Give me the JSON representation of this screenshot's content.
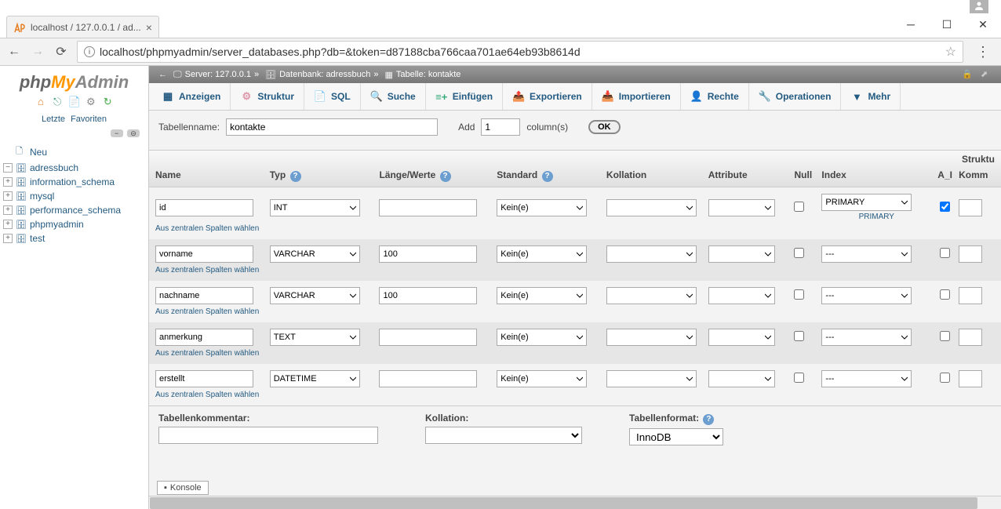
{
  "browser": {
    "tab_title": "localhost / 127.0.0.1 / ad...",
    "url": "localhost/phpmyadmin/server_databases.php?db=&token=d87188cba766caa701ae64eb93b8614d"
  },
  "sidebar": {
    "recent": "Letzte",
    "favorites": "Favoriten",
    "new": "Neu",
    "databases": [
      "adressbuch",
      "information_schema",
      "mysql",
      "performance_schema",
      "phpmyadmin",
      "test"
    ]
  },
  "breadcrumb": {
    "server_label": "Server:",
    "server": "127.0.0.1",
    "db_label": "Datenbank:",
    "db": "adressbuch",
    "table_label": "Tabelle:",
    "table": "kontakte"
  },
  "tabs": {
    "browse": "Anzeigen",
    "structure": "Struktur",
    "sql": "SQL",
    "search": "Suche",
    "insert": "Einfügen",
    "export": "Exportieren",
    "import": "Importieren",
    "privileges": "Rechte",
    "operations": "Operationen",
    "more": "Mehr"
  },
  "form": {
    "tablename_label": "Tabellenname:",
    "tablename": "kontakte",
    "add_label": "Add",
    "add_count": "1",
    "columns_label": "column(s)",
    "ok": "OK"
  },
  "headers": {
    "structure": "Struktu",
    "name": "Name",
    "type": "Typ",
    "length": "Länge/Werte",
    "default": "Standard",
    "collation": "Kollation",
    "attributes": "Attribute",
    "null": "Null",
    "index": "Index",
    "ai": "A_I",
    "comment": "Komm"
  },
  "rows": [
    {
      "name": "id",
      "type": "INT",
      "length": "",
      "default": "Kein(e)",
      "collation": "",
      "attributes": "",
      "null": false,
      "index": "PRIMARY",
      "index_sub": "PRIMARY",
      "ai": true
    },
    {
      "name": "vorname",
      "type": "VARCHAR",
      "length": "100",
      "default": "Kein(e)",
      "collation": "",
      "attributes": "",
      "null": false,
      "index": "---",
      "ai": false
    },
    {
      "name": "nachname",
      "type": "VARCHAR",
      "length": "100",
      "default": "Kein(e)",
      "collation": "",
      "attributes": "",
      "null": false,
      "index": "---",
      "ai": false
    },
    {
      "name": "anmerkung",
      "type": "TEXT",
      "length": "",
      "default": "Kein(e)",
      "collation": "",
      "attributes": "",
      "null": false,
      "index": "---",
      "ai": false
    },
    {
      "name": "erstellt",
      "type": "DATETIME",
      "length": "",
      "default": "Kein(e)",
      "collation": "",
      "attributes": "",
      "null": false,
      "index": "---",
      "ai": false
    }
  ],
  "central_link": "Aus zentralen Spalten wählen",
  "footer": {
    "comment_label": "Tabellenkommentar:",
    "collation_label": "Kollation:",
    "format_label": "Tabellenformat:",
    "format_value": "InnoDB"
  },
  "konsole": "Konsole"
}
